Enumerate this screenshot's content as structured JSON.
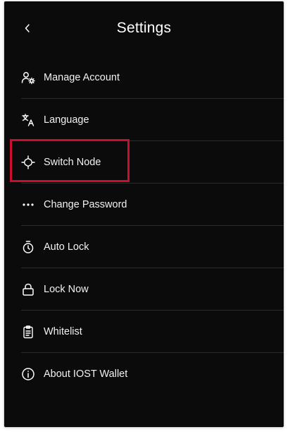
{
  "header": {
    "title": "Settings"
  },
  "menu": {
    "items": [
      {
        "label": "Manage Account"
      },
      {
        "label": "Language"
      },
      {
        "label": "Switch Node"
      },
      {
        "label": "Change Password"
      },
      {
        "label": "Auto Lock"
      },
      {
        "label": "Lock Now"
      },
      {
        "label": "Whitelist"
      },
      {
        "label": "About IOST Wallet"
      }
    ]
  },
  "icons": {
    "back": "chevron-left-icon",
    "manage_account": "user-gear-icon",
    "language": "translate-icon",
    "switch_node": "node-icon",
    "change_password": "dots-icon",
    "auto_lock": "timer-icon",
    "lock_now": "lock-icon",
    "whitelist": "clipboard-list-icon",
    "about": "info-icon"
  },
  "colors": {
    "background": "#0b0b0b",
    "text": "#f2f2f2",
    "divider": "#2a2a2a",
    "highlight": "#c8102e"
  }
}
